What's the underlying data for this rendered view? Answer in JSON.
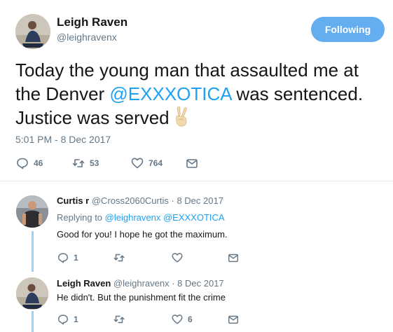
{
  "main_tweet": {
    "author_name": "Leigh Raven",
    "author_handle": "@leighravenx",
    "follow_label": "Following",
    "text_before": "Today the young man that assaulted me at the Denver ",
    "mention": "@EXXXOTICA",
    "text_after": " was sentenced. Justice was served",
    "emoji": "victory-hand-emoji",
    "timestamp": "5:01 PM - 8 Dec 2017",
    "replies": "46",
    "retweets": "53",
    "likes": "764"
  },
  "replies": [
    {
      "name": "Curtis r",
      "handle": "@Cross2060Curtis",
      "date": "· 8 Dec 2017",
      "replying_to_label": "Replying to",
      "replying_to": "@leighravenx @EXXXOTICA",
      "text": "Good for you! I hope he got the maximum.",
      "reply_count": "1",
      "retweet_count": "",
      "like_count": ""
    },
    {
      "name": "Leigh Raven",
      "handle": "@leighravenx",
      "date": "· 8 Dec 2017",
      "text": "He didn't. But the punishment fit the crime",
      "reply_count": "1",
      "retweet_count": "",
      "like_count": "6"
    }
  ],
  "colors": {
    "accent": "#1da1f2",
    "follow_button": "#64aeef",
    "muted": "#657786",
    "thread_line": "#9fd0f5"
  }
}
